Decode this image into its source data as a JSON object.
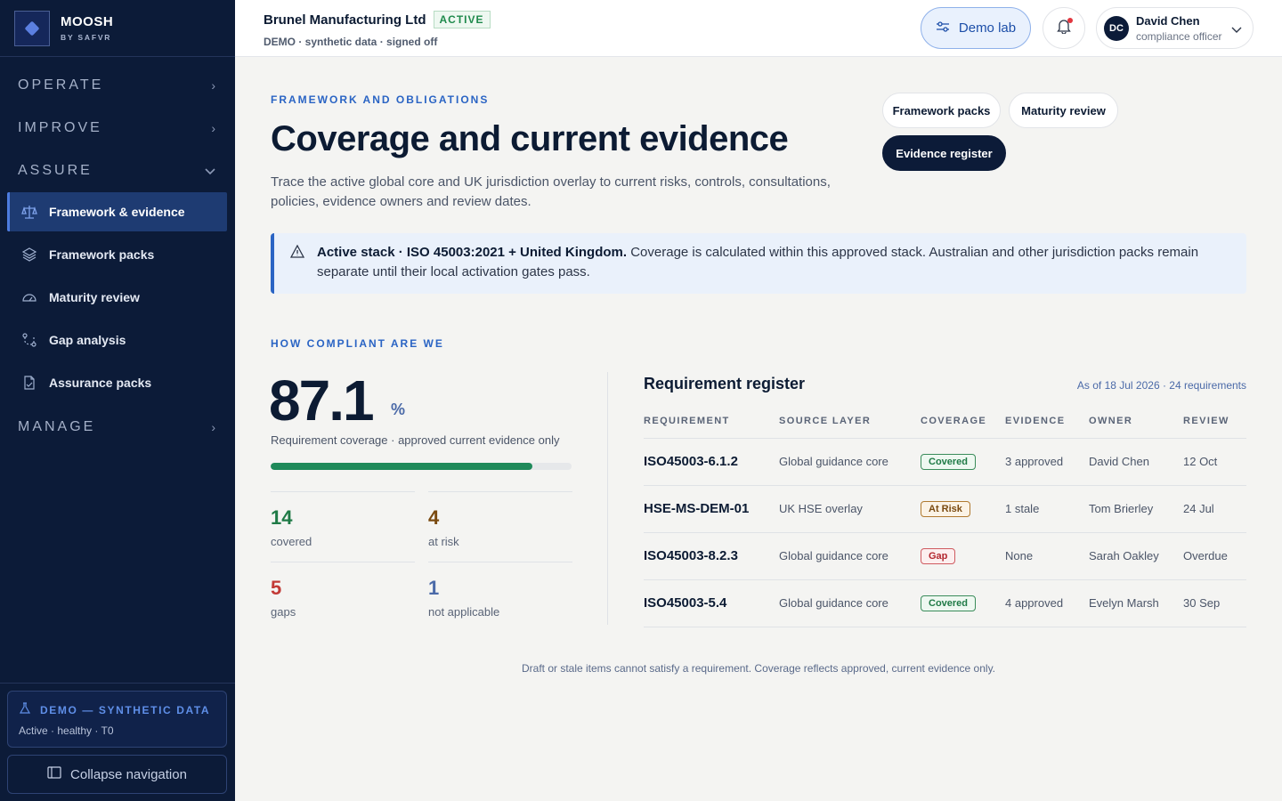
{
  "brand": {
    "name": "MOOSH",
    "sub": "BY SAFVR"
  },
  "nav": {
    "sections": [
      {
        "label": "OPERATE",
        "chevron": "›"
      },
      {
        "label": "IMPROVE",
        "chevron": "›"
      },
      {
        "label": "ASSURE",
        "chevron": "⌄"
      },
      {
        "label": "MANAGE",
        "chevron": "›"
      }
    ],
    "items": [
      {
        "label": "Framework & evidence",
        "icon": "scale-icon"
      },
      {
        "label": "Framework packs",
        "icon": "layers-icon"
      },
      {
        "label": "Maturity review",
        "icon": "gauge-icon"
      },
      {
        "label": "Gap analysis",
        "icon": "route-icon"
      },
      {
        "label": "Assurance packs",
        "icon": "file-check-icon"
      }
    ]
  },
  "demo_box": {
    "title": "DEMO — SYNTHETIC DATA",
    "sub": "Active · healthy · T0"
  },
  "collapse_label": "Collapse navigation",
  "topbar": {
    "org_name": "Brunel Manufacturing Ltd",
    "org_status": "ACTIVE",
    "org_sub": "DEMO · synthetic data · signed off",
    "demo_lab": "Demo lab",
    "user": {
      "initials": "DC",
      "name": "David Chen",
      "role": "compliance officer"
    }
  },
  "page": {
    "eyebrow": "FRAMEWORK AND OBLIGATIONS",
    "title": "Coverage and current evidence",
    "description": "Trace the active global core and UK jurisdiction overlay to current risks, controls, consultations, policies, evidence owners and review dates.",
    "buttons": {
      "framework_packs": "Framework packs",
      "maturity_review": "Maturity review",
      "evidence_register": "Evidence register"
    }
  },
  "alert": {
    "bold": "Active stack · ISO 45003:2021 + United Kingdom.",
    "text": " Coverage is calculated within this approved stack. Australian and other jurisdiction packs remain separate until their local activation gates pass."
  },
  "compliance": {
    "label": "HOW COMPLIANT ARE WE",
    "value": "87.1",
    "unit": "%",
    "progress": 0.871,
    "caption": "Requirement coverage · approved current evidence only",
    "stats": [
      {
        "num": "14",
        "label": "covered",
        "color": "#1f7a46"
      },
      {
        "num": "4",
        "label": "at risk",
        "color": "#7a4a10"
      },
      {
        "num": "5",
        "label": "gaps",
        "color": "#c23a36"
      },
      {
        "num": "1",
        "label": "not applicable",
        "color": "#4b6aa8"
      }
    ]
  },
  "register": {
    "title": "Requirement register",
    "meta": "As of 18 Jul 2026 · 24 requirements",
    "columns": [
      "REQUIREMENT",
      "SOURCE LAYER",
      "COVERAGE",
      "EVIDENCE",
      "OWNER",
      "REVIEW"
    ],
    "rows": [
      {
        "req": "ISO45003-6.1.2",
        "source": "Global guidance core",
        "coverage": "Covered",
        "evidence": "3 approved",
        "owner": "David Chen",
        "review": "12 Oct"
      },
      {
        "req": "HSE-MS-DEM-01",
        "source": "UK HSE overlay",
        "coverage": "At Risk",
        "evidence": "1 stale",
        "owner": "Tom Brierley",
        "review": "24 Jul"
      },
      {
        "req": "ISO45003-8.2.3",
        "source": "Global guidance core",
        "coverage": "Gap",
        "evidence": "None",
        "owner": "Sarah Oakley",
        "review": "Overdue"
      },
      {
        "req": "ISO45003-5.4",
        "source": "Global guidance core",
        "coverage": "Covered",
        "evidence": "4 approved",
        "owner": "Evelyn Marsh",
        "review": "30 Sep"
      }
    ]
  },
  "footnote": "Draft or stale items cannot satisfy a requirement. Coverage reflects approved, current evidence only."
}
